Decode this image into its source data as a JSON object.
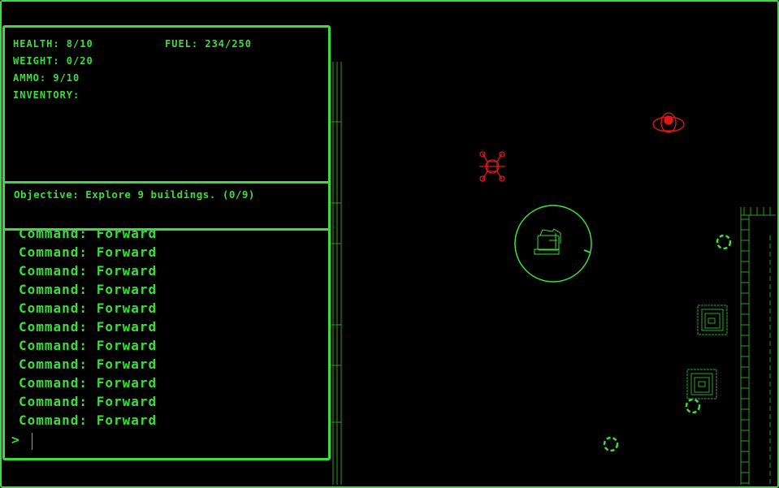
{
  "stats": {
    "health": "HEALTH: 8/10",
    "weight": "WEIGHT: 0/20",
    "ammo": "AMMO: 9/10",
    "inventory": "INVENTORY:",
    "fuel": "FUEL: 234/250"
  },
  "objective": "Objective: Explore 9 buildings. (0/9)",
  "console": {
    "lines": [
      "Command: Forward",
      "Command: Forward",
      "Command: Forward",
      "Command: Forward",
      "Command: Forward",
      "Command: Forward",
      "Command: Forward",
      "Command: Forward",
      "Command: Forward",
      "Command: Forward",
      "Command: Forward"
    ],
    "prompt": ">"
  },
  "colors": {
    "terminal_green": "#3ddc3d",
    "enemy_red": "#e01818",
    "background": "#000000"
  },
  "map": {
    "player": "tank-icon",
    "enemies": [
      "crab-drone-icon",
      "scout-ship-icon"
    ],
    "buildings": [
      "building-icon",
      "building-icon"
    ],
    "pickups": [
      "ring-marker-icon",
      "ring-marker-icon",
      "ring-marker-icon"
    ]
  }
}
